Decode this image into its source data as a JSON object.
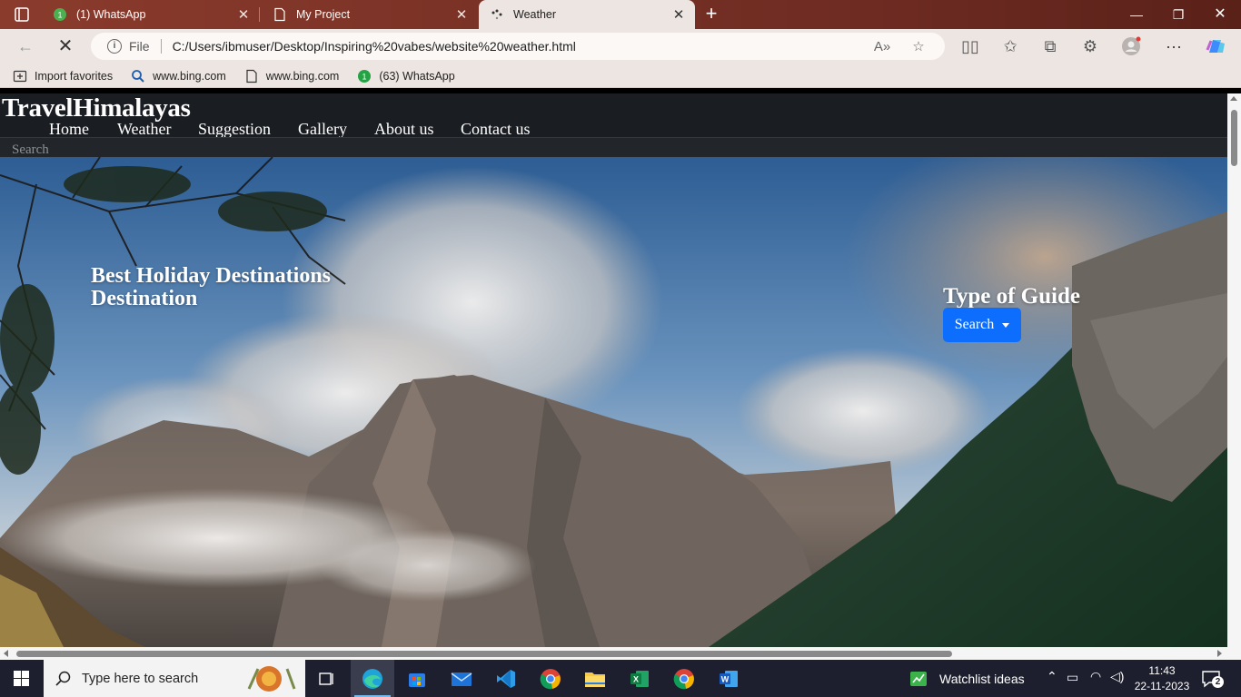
{
  "browser": {
    "tabs": [
      {
        "title": "(1) WhatsApp",
        "icon": "whatsapp-icon"
      },
      {
        "title": "My Project",
        "icon": "page-icon"
      },
      {
        "title": "Weather",
        "icon": "loading-icon"
      }
    ],
    "active_tab": 2,
    "address": {
      "scheme_label": "File",
      "url": "C:/Users/ibmuser/Desktop/Inspiring%20vabes/website%20weather.html"
    },
    "favorites": [
      {
        "label": "Import favorites",
        "icon": "import-icon"
      },
      {
        "label": "www.bing.com",
        "icon": "bing-icon"
      },
      {
        "label": "www.bing.com",
        "icon": "page-icon"
      },
      {
        "label": "(63) WhatsApp",
        "icon": "whatsapp-icon"
      }
    ],
    "accent": "#8a3b2c"
  },
  "site": {
    "brand": "TravelHimalayas",
    "nav": [
      "Home",
      "Weather",
      "Suggestion",
      "Gallery",
      "About us",
      "Contact us"
    ],
    "search_placeholder": "Search",
    "headline_line1": "Best Holiday Destinations",
    "headline_line2": "Destination",
    "guide_title": "Type of Guide",
    "guide_button": "Search",
    "button_color": "#0d6efd"
  },
  "taskbar": {
    "search_placeholder": "Type here to search",
    "watchlist": "Watchlist ideas",
    "time": "11:43",
    "date": "22-11-2023",
    "notification_count": "2"
  }
}
